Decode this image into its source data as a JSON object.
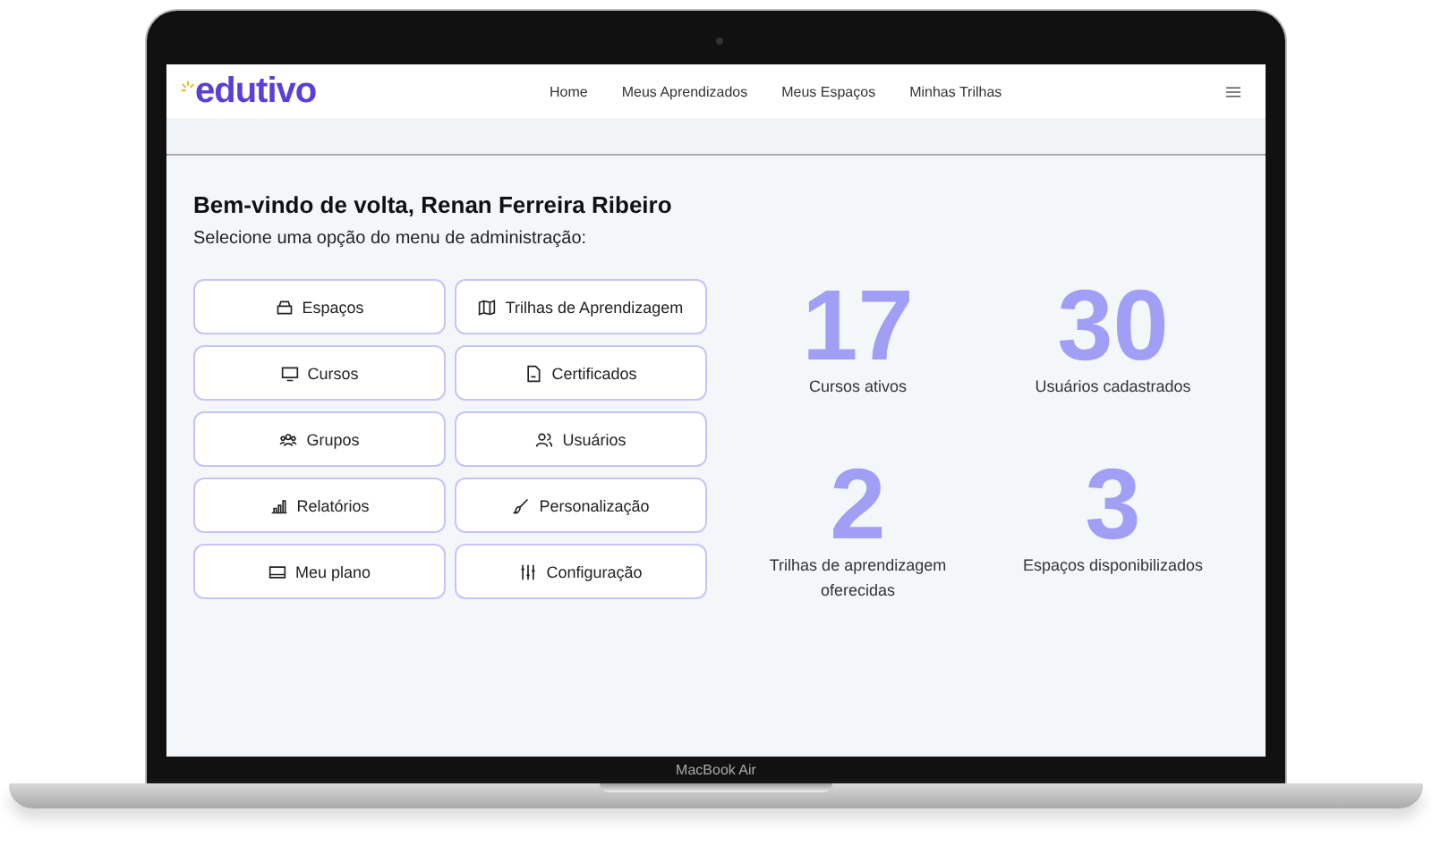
{
  "device": {
    "label": "MacBook Air"
  },
  "navbar": {
    "brand": "edutivo",
    "links": [
      {
        "label": "Home"
      },
      {
        "label": "Meus Aprendizados"
      },
      {
        "label": "Meus Espaços"
      },
      {
        "label": "Minhas Trilhas"
      }
    ]
  },
  "welcome": {
    "title": "Bem-vindo de volta, Renan Ferreira Ribeiro",
    "subtitle": "Selecione uma opção do menu de administração:"
  },
  "menu": [
    {
      "label": "Espaços"
    },
    {
      "label": "Trilhas de Aprendizagem"
    },
    {
      "label": "Cursos"
    },
    {
      "label": "Certificados"
    },
    {
      "label": "Grupos"
    },
    {
      "label": "Usuários"
    },
    {
      "label": "Relatórios"
    },
    {
      "label": "Personalização"
    },
    {
      "label": "Meu plano"
    },
    {
      "label": "Configuração"
    }
  ],
  "stats": [
    {
      "value": "17",
      "label": "Cursos ativos"
    },
    {
      "value": "30",
      "label": "Usuários cadastrados"
    },
    {
      "value": "2",
      "label": "Trilhas de aprendizagem oferecidas"
    },
    {
      "value": "3",
      "label": "Espaços disponibilizados"
    }
  ]
}
